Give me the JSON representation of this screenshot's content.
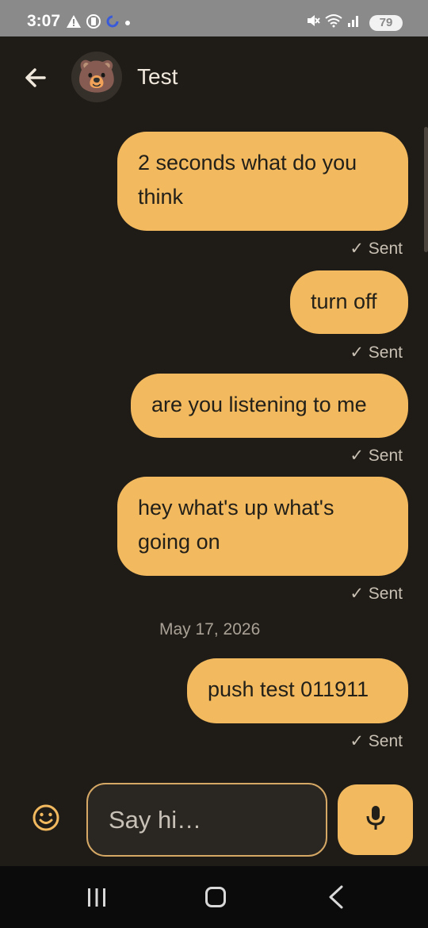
{
  "status_bar": {
    "time": "3:07",
    "battery": "79",
    "left_icons": [
      "warning-icon",
      "vibrate-icon",
      "sync-icon",
      "dot-icon"
    ],
    "right_icons": [
      "mute-icon",
      "wifi-icon",
      "signal-icon",
      "battery-icon"
    ]
  },
  "header": {
    "back_icon": "arrow-left-icon",
    "avatar_emoji": "🐻",
    "contact_name": "Test"
  },
  "messages": [
    {
      "lines": [
        "2 seconds what do you",
        "think"
      ],
      "status": "✓ Sent"
    },
    {
      "lines": [
        "turn off"
      ],
      "status": "✓ Sent"
    },
    {
      "lines": [
        "are you listening to me"
      ],
      "status": "✓ Sent"
    },
    {
      "lines": [
        "hey what's up what's",
        "going on"
      ],
      "status": "✓ Sent"
    },
    {
      "date_separator": "May 17, 2026"
    },
    {
      "lines": [
        "push test 011911"
      ],
      "status": "✓ Sent"
    }
  ],
  "composer": {
    "emoji_icon": "smiley-icon",
    "placeholder": "Say hi…",
    "mic_icon": "microphone-icon"
  },
  "nav_bar": {
    "icons": [
      "recents-icon",
      "home-icon",
      "back-icon"
    ]
  },
  "colors": {
    "background": "#1f1c17",
    "bubble": "#f2b95f",
    "accent": "#f2b95f"
  }
}
